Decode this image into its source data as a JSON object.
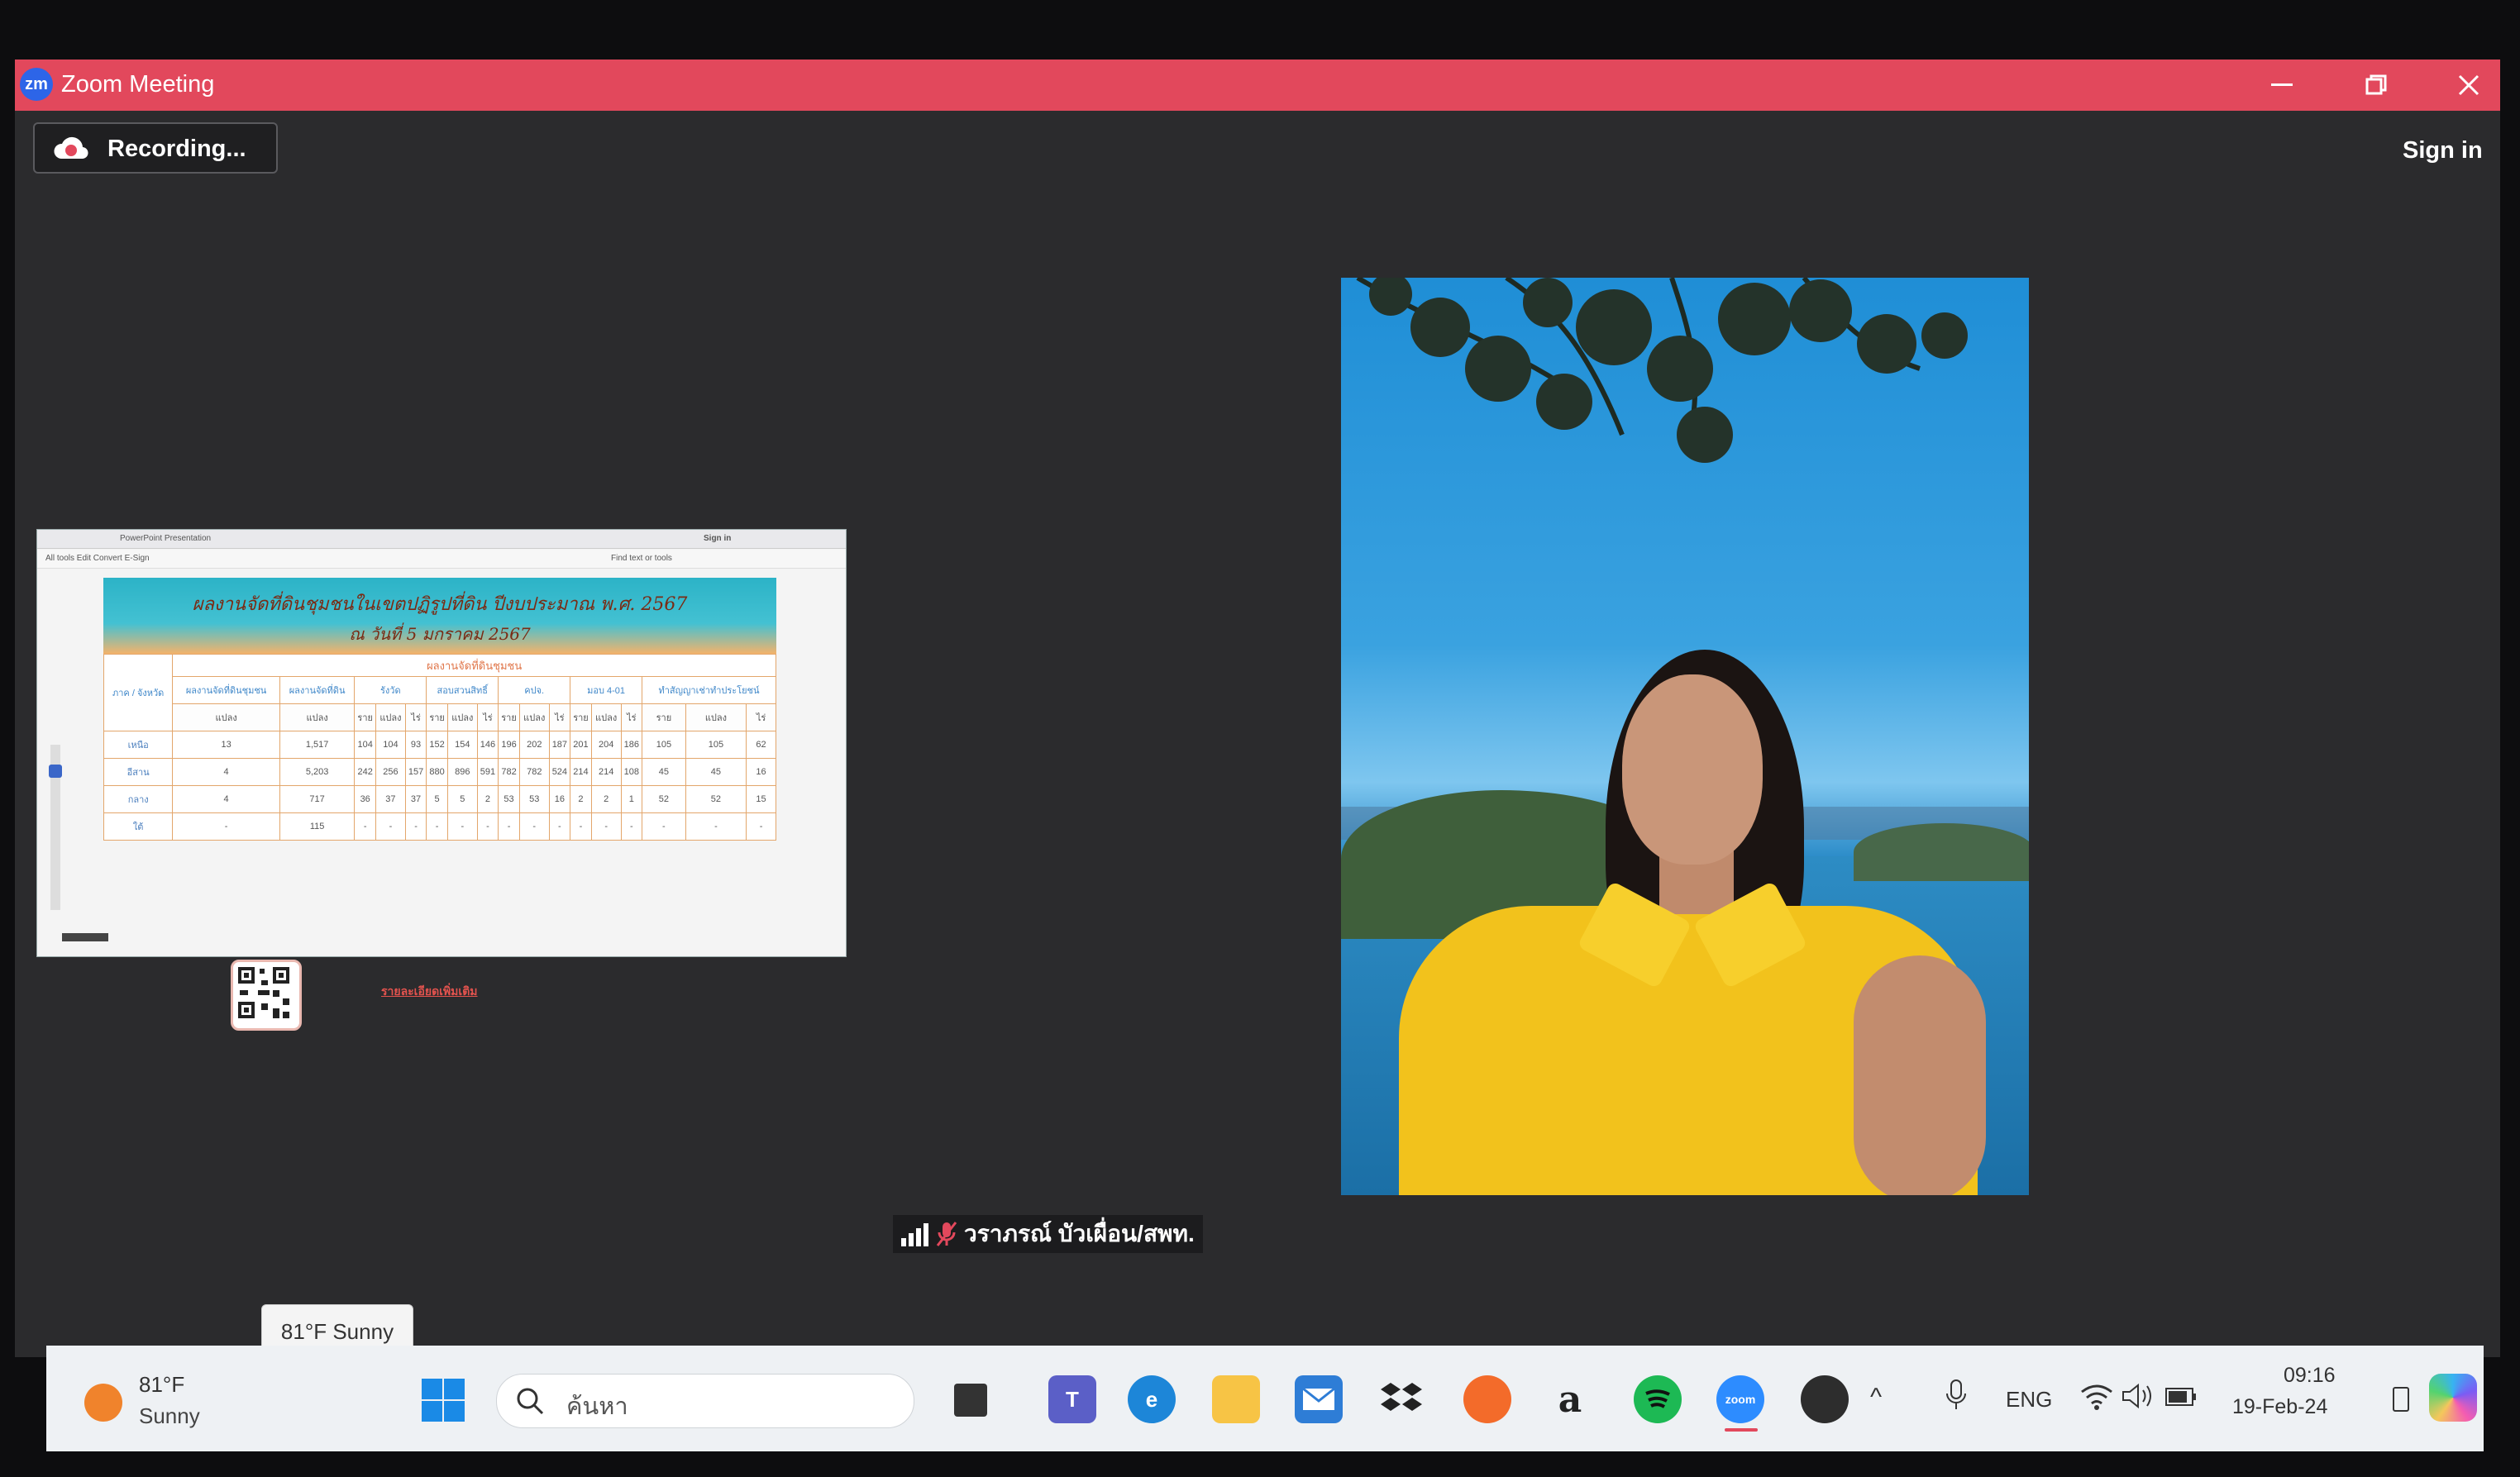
{
  "window": {
    "app_title": "Zoom Meeting",
    "logo_text": "zm",
    "controls": [
      "minimize",
      "restore",
      "close"
    ]
  },
  "meeting": {
    "recording_label": "Recording...",
    "sign_in_label": "Sign in"
  },
  "shared_screen": {
    "browser_tab": "PowerPoint Presentation",
    "sign_in": "Sign in",
    "tools_label": "All tools   Edit   Convert   E-Sign",
    "find_label": "Find text or tools",
    "slide_title_line1": "ผลงานจัดที่ดินชุมชนในเขตปฏิรูปที่ดิน ปีงบประมาณ พ.ศ. 2567",
    "slide_title_line2": "ณ วันที่ 5 มกราคม 2567",
    "table_section_header": "ผลงานจัดที่ดินชุมชน",
    "group_headers": [
      "ภาค / จังหวัด",
      "ผลงานจัดที่ดินชุมชน",
      "ผลงานจัดที่ดิน",
      "รังวัด",
      "สอบสวนสิทธิ์",
      "คปจ.",
      "มอบ 4-01",
      "ทำสัญญาเช่าทำประโยชน์"
    ],
    "sub_headers": [
      "แปลง",
      "แปลง",
      "ราย",
      "แปลง",
      "ไร่",
      "ราย",
      "แปลง",
      "ไร่",
      "ราย",
      "แปลง",
      "ไร่",
      "ราย",
      "แปลง",
      "ไร่",
      "ราย",
      "แปลง",
      "ไร่"
    ],
    "rows": [
      {
        "label": "เหนือ",
        "cells": [
          "13",
          "1,517",
          "104",
          "104",
          "93",
          "152",
          "154",
          "146",
          "196",
          "202",
          "187",
          "201",
          "204",
          "186",
          "105",
          "105",
          "62"
        ]
      },
      {
        "label": "อีสาน",
        "cells": [
          "4",
          "5,203",
          "242",
          "256",
          "157",
          "880",
          "896",
          "591",
          "782",
          "782",
          "524",
          "214",
          "214",
          "108",
          "45",
          "45",
          "16"
        ]
      },
      {
        "label": "กลาง",
        "cells": [
          "4",
          "717",
          "36",
          "37",
          "37",
          "5",
          "5",
          "2",
          "53",
          "53",
          "16",
          "2",
          "2",
          "1",
          "52",
          "52",
          "15"
        ]
      },
      {
        "label": "ใต้",
        "cells": [
          "-",
          "115",
          "-",
          "-",
          "-",
          "-",
          "-",
          "-",
          "-",
          "-",
          "-",
          "-",
          "-",
          "-",
          "-",
          "-",
          "-"
        ]
      }
    ],
    "more_details_link": "รายละเอียดเพิ่มเติม"
  },
  "participant": {
    "name": "วราภรณ์ บัวเผื่อน/สพท."
  },
  "weather_tooltip": "81°F Sunny",
  "taskbar": {
    "weather_temp": "81°F",
    "weather_condition": "Sunny",
    "search_placeholder": "ค้นหา",
    "apps": [
      "task-view",
      "teams",
      "edge",
      "file-explorer",
      "mail",
      "dropbox",
      "firefox",
      "amazon",
      "spotify",
      "zoom",
      "obs"
    ],
    "zoom_label": "zoom",
    "amazon_label": "a",
    "language": "ENG",
    "time": "09:16",
    "date": "19-Feb-24"
  },
  "colors": {
    "titlebar": "#e2485c",
    "zoom_blue": "#2d8cff",
    "shirt": "#f2c21c"
  }
}
